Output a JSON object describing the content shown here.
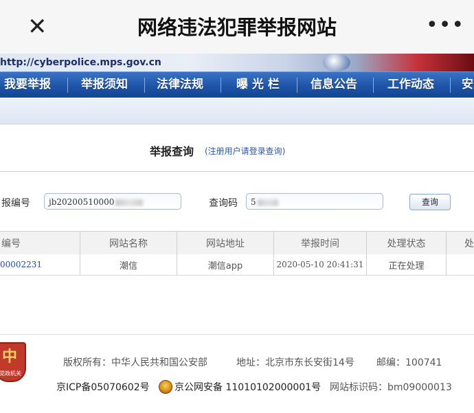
{
  "app": {
    "title": "网络违法犯罪举报网站",
    "close_glyph": "✕",
    "more_glyph": "•••"
  },
  "banner": {
    "url": "http://cyberpolice.mps.gov.cn"
  },
  "nav": {
    "items": [
      "我要举报",
      "举报须知",
      "法律法规",
      "曝 光 栏",
      "信息公告",
      "工作动态",
      "安"
    ]
  },
  "query": {
    "title": "举报查询",
    "note": "(注册用户请登录查询)",
    "report_no_label": "报编号",
    "report_no_value": "jb20200510000",
    "code_label": "查询码",
    "code_value": "5",
    "button_label": "查询"
  },
  "table": {
    "headers": [
      "编号",
      "网站名称",
      "网站地址",
      "举报时间",
      "处理状态",
      "处"
    ],
    "rows": [
      [
        "00002231",
        "潮信",
        "潮信app",
        "2020-05-10 20:41:31",
        "正在处理",
        ""
      ]
    ]
  },
  "footer": {
    "emblem_caption": "党政机关",
    "emblem_glyph": "中",
    "line1": {
      "copyright": "版权所有：中华人民共和国公安部",
      "address": "地址：北京市东长安街14号",
      "postcode": "邮编：100741"
    },
    "line2": {
      "icp": "京ICP备05070602号",
      "police": "京公网安备 11010102000001号",
      "site_id": "网站标识码：bm09000013"
    }
  },
  "colors": {
    "nav_blue": "#1d54a8",
    "link_blue": "#1f4fa0",
    "emblem_red": "#c0392b"
  }
}
